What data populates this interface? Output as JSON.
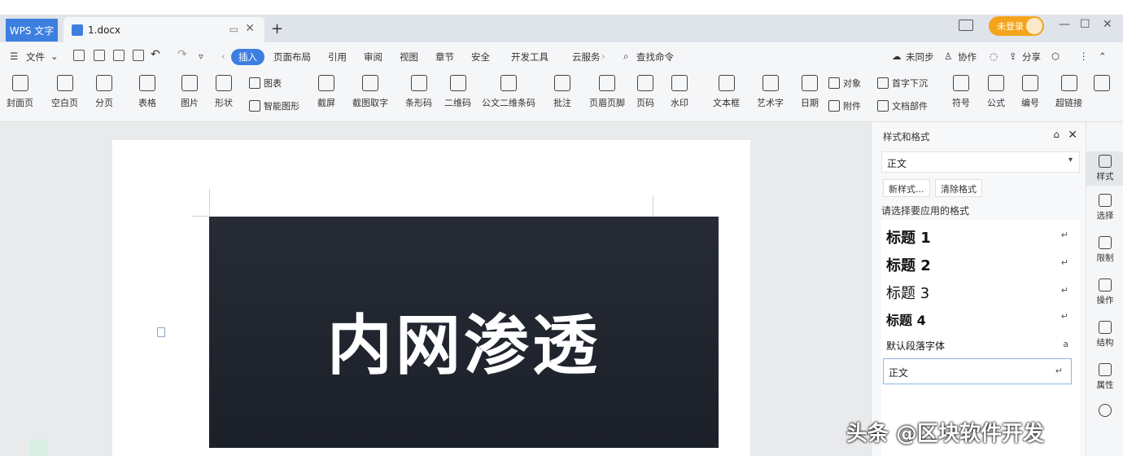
{
  "titlebar": {
    "app_tab": "WPS 文字",
    "doc_tab": "1.docx",
    "new_tab": "+",
    "login": "未登录",
    "win_minimize": "—",
    "win_restore": "☐",
    "win_close": "✕",
    "doc_tab_close": "✕",
    "doc_tab_pin": "▭"
  },
  "menubar": {
    "file": "文件",
    "tabs": [
      "插入",
      "页面布局",
      "引用",
      "审阅",
      "视图",
      "章节",
      "安全",
      "开发工具",
      "云服务"
    ],
    "active_tab": "插入",
    "search": "查找命令",
    "right_items": [
      "未同步",
      "协作",
      "分享"
    ]
  },
  "ribbon": {
    "items": [
      "封面页",
      "空白页",
      "分页",
      "表格",
      "图片",
      "形状",
      "截屏",
      "截图取字",
      "条形码",
      "二维码",
      "公文二维条码",
      "批注",
      "页眉页脚",
      "页码",
      "水印",
      "文本框",
      "艺术字",
      "日期",
      "符号",
      "公式",
      "编号",
      "超链接"
    ],
    "small_items": [
      "图表",
      "智能图形",
      "对象",
      "首字下沉",
      "附件",
      "文档部件"
    ]
  },
  "document": {
    "banner_text": "内网渗透"
  },
  "sidepanel": {
    "title": "样式和格式",
    "current_style": "正文",
    "new_style_btn": "新样式...",
    "clear_format_btn": "清除格式",
    "hint": "请选择要应用的格式",
    "styles": [
      "标题 1",
      "标题 2",
      "标题 3",
      "标题 4",
      "默认段落字体"
    ],
    "selected_style": "正文"
  },
  "rail": {
    "items": [
      "样式",
      "选择",
      "限制",
      "操作",
      "结构",
      "属性"
    ]
  },
  "watermark": "头条 @区块软件开发",
  "colors": {
    "accent": "#3d7fe0",
    "login_pill": "#f3a41b",
    "banner_bg": "#1f232c"
  }
}
